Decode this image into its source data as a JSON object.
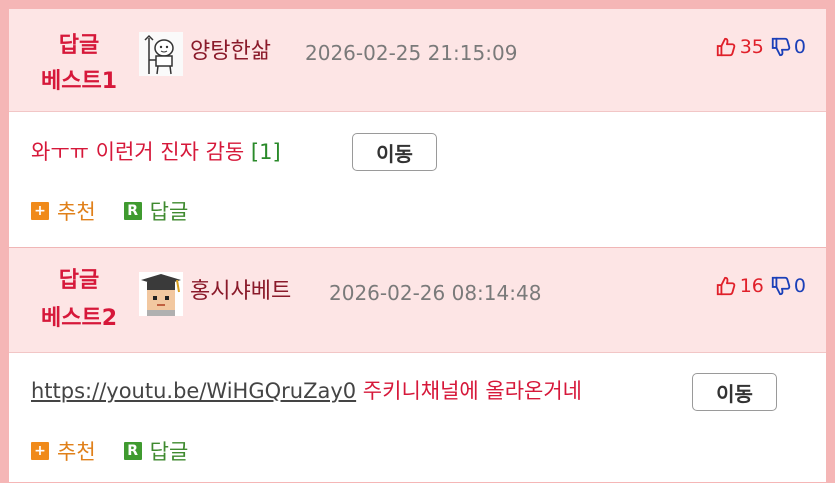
{
  "comments": [
    {
      "badge_line1": "답글",
      "badge_line2": "베스트1",
      "nickname": "양탕한삶",
      "datetime": "2026-02-25 21:15:09",
      "upvotes": "35",
      "downvotes": "0",
      "text": "와ㅜㅠ 이런거 진자 감동",
      "reply_count": "[1]",
      "link": "",
      "move_label": "이동",
      "recommend_label": "추천",
      "reply_label": "답글"
    },
    {
      "badge_line1": "답글",
      "badge_line2": "베스트2",
      "nickname": "홍시샤베트",
      "datetime": "2026-02-26 08:14:48",
      "upvotes": "16",
      "downvotes": "0",
      "link": "https://youtu.be/WiHGQruZay0",
      "text": " 주키니채널에 올라온거네",
      "move_label": "이동",
      "recommend_label": "추천",
      "reply_label": "답글"
    }
  ],
  "colors": {
    "best_red": "#d6183a",
    "upvote_red": "#e0202a",
    "downvote_blue": "#1a3fb8",
    "header_pink": "#fde5e5",
    "frame_pink": "#f5b6b6"
  },
  "icons": [
    "thumbs-up-icon",
    "thumbs-down-icon",
    "plus-icon",
    "reply-r-icon"
  ]
}
